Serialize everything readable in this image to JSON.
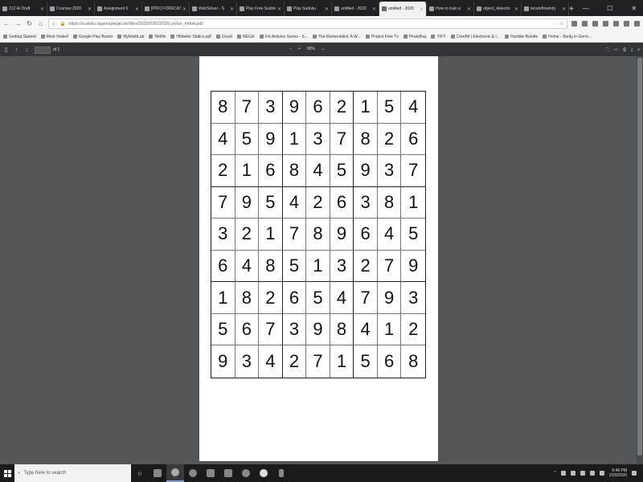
{
  "tabs": [
    {
      "title": "212 AI Draft",
      "active": false
    },
    {
      "title": "Courses 2020",
      "active": false
    },
    {
      "title": "Assignment 5",
      "active": false
    },
    {
      "title": "[PDF] FORECAS",
      "active": false
    },
    {
      "title": "WebSolver - S",
      "active": false
    },
    {
      "title": "Play Free Sudoku",
      "active": false
    },
    {
      "title": "Play Sudoku",
      "active": false
    },
    {
      "title": "untitled - 2020",
      "active": false
    },
    {
      "title": "untitled - 2020",
      "active": true
    },
    {
      "title": "How to train a",
      "active": false
    },
    {
      "title": "object_detectio",
      "active": false
    },
    {
      "title": "tensorflow/obj",
      "active": false
    }
  ],
  "navbar": {
    "url": "https://sudoku.tagesspiegel.de/files/2020/20022020_solve_mittel.pdf"
  },
  "bookmarks": [
    "Getting Started",
    "Most Visited",
    "Google Play Books",
    "MyMathLab",
    "Netflix",
    "Hibbeler Statics.pdf",
    "Cloud",
    "MEGA",
    "For Arduino Series - S...",
    "The Elementalist: A W...",
    "Project Free Tv",
    "PirateBay",
    "YIFY",
    "CoreBit | Electronic & I...",
    "Humble Bundle",
    "Home - Study in Germ..."
  ],
  "pdf_toolbar": {
    "page_total": "of 1",
    "zoom": "90%"
  },
  "sudoku": [
    [
      8,
      7,
      3,
      9,
      6,
      2,
      1,
      5,
      4
    ],
    [
      4,
      5,
      9,
      1,
      3,
      7,
      8,
      2,
      6
    ],
    [
      2,
      1,
      6,
      8,
      4,
      5,
      9,
      3,
      7
    ],
    [
      7,
      9,
      5,
      4,
      2,
      6,
      3,
      8,
      1
    ],
    [
      3,
      2,
      1,
      7,
      8,
      9,
      6,
      4,
      5
    ],
    [
      6,
      4,
      8,
      5,
      1,
      3,
      2,
      7,
      9
    ],
    [
      1,
      8,
      2,
      6,
      5,
      4,
      7,
      9,
      3
    ],
    [
      5,
      6,
      7,
      3,
      9,
      8,
      4,
      1,
      2
    ],
    [
      9,
      3,
      4,
      2,
      7,
      1,
      5,
      6,
      8
    ]
  ],
  "taskbar": {
    "search_placeholder": "Type here to search",
    "time": "9:46 PM",
    "date": "2/20/2020"
  }
}
